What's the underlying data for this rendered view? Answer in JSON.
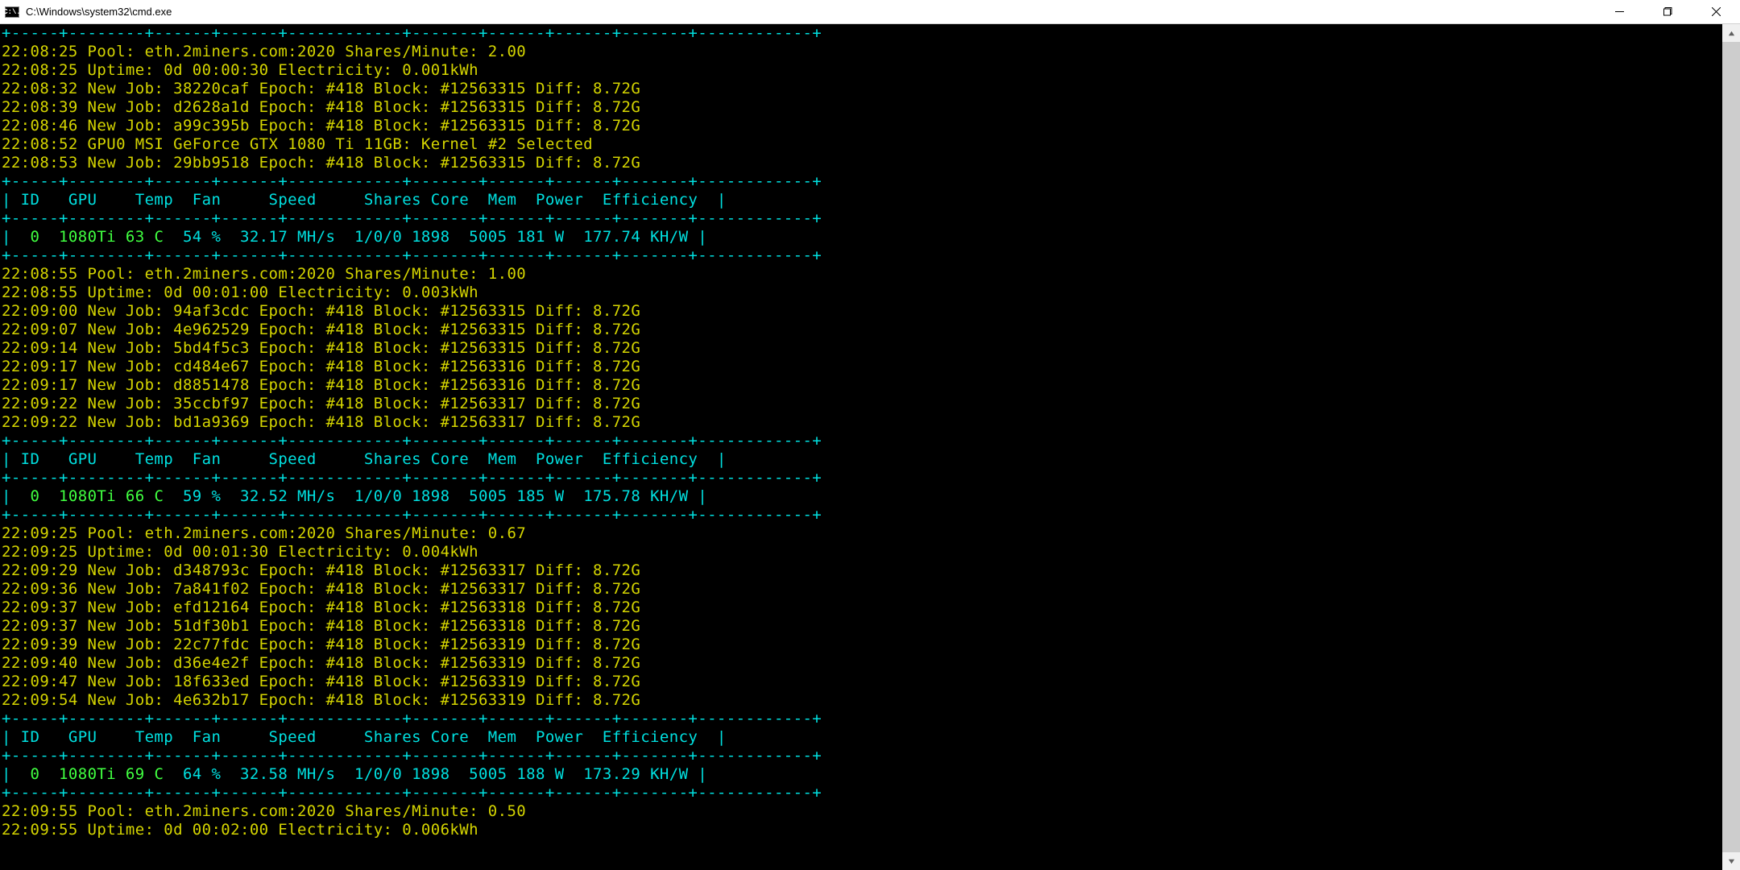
{
  "titlebar": {
    "icon_label": "C:\\.",
    "title": "C:\\Windows\\system32\\cmd.exe",
    "min_name": "minimize",
    "max_name": "maximize",
    "close_name": "close"
  },
  "table": {
    "border_top": "+-----+--------+------+------+------------+-------+------+------+-------+------------+",
    "border_mid": "+-----+--------+------+------+------------+-------+------+------+-------+------------+",
    "border_bottom": "+-----+--------+------+------+------------+-------+------+------+-------+------------+",
    "header": "| ID   GPU    Temp  Fan     Speed     Shares Core  Mem  Power  Efficiency  |"
  },
  "blocks": [
    {
      "pool": "22:08:25 Pool: eth.2miners.com:2020 Shares/Minute: 2.00",
      "uptime": "22:08:25 Uptime: 0d 00:00:30 Electricity: 0.001kWh",
      "jobs": [
        "22:08:32 New Job: 38220caf Epoch: #418 Block: #12563315 Diff: 8.72G",
        "22:08:39 New Job: d2628a1d Epoch: #418 Block: #12563315 Diff: 8.72G",
        "22:08:46 New Job: a99c395b Epoch: #418 Block: #12563315 Diff: 8.72G",
        "22:08:52 GPU0 MSI GeForce GTX 1080 Ti 11GB: Kernel #2 Selected",
        "22:08:53 New Job: 29bb9518 Epoch: #418 Block: #12563315 Diff: 8.72G"
      ],
      "gpu_row": {
        "id": "0",
        "gpu": "1080Ti",
        "temp": "63 C",
        "rest": "  54 %  32.17 MH/s  1/0/0 1898  5005 181 W  177.74 KH/W |"
      }
    },
    {
      "pool": "22:08:55 Pool: eth.2miners.com:2020 Shares/Minute: 1.00",
      "uptime": "22:08:55 Uptime: 0d 00:01:00 Electricity: 0.003kWh",
      "jobs": [
        "22:09:00 New Job: 94af3cdc Epoch: #418 Block: #12563315 Diff: 8.72G",
        "22:09:07 New Job: 4e962529 Epoch: #418 Block: #12563315 Diff: 8.72G",
        "22:09:14 New Job: 5bd4f5c3 Epoch: #418 Block: #12563315 Diff: 8.72G",
        "22:09:17 New Job: cd484e67 Epoch: #418 Block: #12563316 Diff: 8.72G",
        "22:09:17 New Job: d8851478 Epoch: #418 Block: #12563316 Diff: 8.72G",
        "22:09:22 New Job: 35ccbf97 Epoch: #418 Block: #12563317 Diff: 8.72G",
        "22:09:22 New Job: bd1a9369 Epoch: #418 Block: #12563317 Diff: 8.72G"
      ],
      "gpu_row": {
        "id": "0",
        "gpu": "1080Ti",
        "temp": "66 C",
        "rest": "  59 %  32.52 MH/s  1/0/0 1898  5005 185 W  175.78 KH/W |"
      }
    },
    {
      "pool": "22:09:25 Pool: eth.2miners.com:2020 Shares/Minute: 0.67",
      "uptime": "22:09:25 Uptime: 0d 00:01:30 Electricity: 0.004kWh",
      "jobs": [
        "22:09:29 New Job: d348793c Epoch: #418 Block: #12563317 Diff: 8.72G",
        "22:09:36 New Job: 7a841f02 Epoch: #418 Block: #12563317 Diff: 8.72G",
        "22:09:37 New Job: efd12164 Epoch: #418 Block: #12563318 Diff: 8.72G",
        "22:09:37 New Job: 51df30b1 Epoch: #418 Block: #12563318 Diff: 8.72G",
        "22:09:39 New Job: 22c77fdc Epoch: #418 Block: #12563319 Diff: 8.72G",
        "22:09:40 New Job: d36e4e2f Epoch: #418 Block: #12563319 Diff: 8.72G",
        "22:09:47 New Job: 18f633ed Epoch: #418 Block: #12563319 Diff: 8.72G",
        "22:09:54 New Job: 4e632b17 Epoch: #418 Block: #12563319 Diff: 8.72G"
      ],
      "gpu_row": {
        "id": "0",
        "gpu": "1080Ti",
        "temp": "69 C",
        "rest": "  64 %  32.58 MH/s  1/0/0 1898  5005 188 W  173.29 KH/W |"
      }
    },
    {
      "pool": "22:09:55 Pool: eth.2miners.com:2020 Shares/Minute: 0.50",
      "uptime": "22:09:55 Uptime: 0d 00:02:00 Electricity: 0.006kWh",
      "jobs": [],
      "gpu_row": null
    }
  ]
}
